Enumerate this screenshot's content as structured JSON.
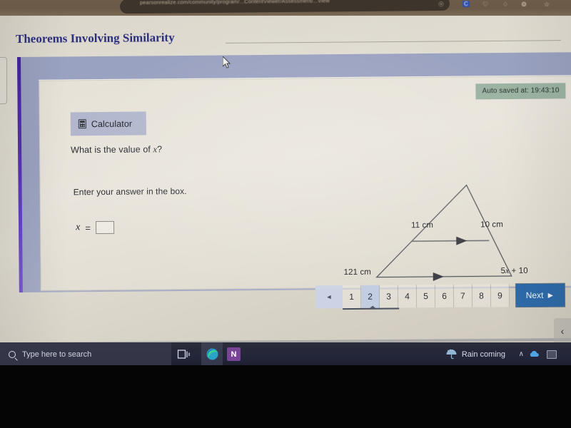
{
  "browser": {
    "url": "pearsonrealize.com/community/program/...ContentViewer/Assessment/...View",
    "toolbar_icons": [
      "account-icon",
      "extensions-icon",
      "favorites-icon",
      "collections-icon",
      "browser-essentials-icon",
      "profile-icon"
    ]
  },
  "page": {
    "heading": "Theorems Involving Similarity"
  },
  "assessment": {
    "autosave": "Auto saved at: 19:43:10",
    "calculator_label": "Calculator",
    "question": "What is the value of x?",
    "question_prefix": "What is the value of ",
    "question_variable": "x",
    "question_suffix": "?",
    "instruction": "Enter your answer in the box.",
    "answer_variable": "x",
    "answer_equals": "=",
    "answer_value": "",
    "answer_placeholder": ""
  },
  "figure": {
    "type": "triangle-with-midsegment",
    "description": "Triangle with a parallel segment (midsegment) drawn across it; arrowheads mark the two parallel lines.",
    "labels": {
      "upper_left_side": "11 cm",
      "upper_right_side": "10 cm",
      "lower_left_side": "121 cm",
      "lower_right_side": "5x + 10"
    },
    "label_upper_right_expression_prefix": "5",
    "label_upper_right_expression_var": "x",
    "label_upper_right_expression_suffix": " + 10"
  },
  "pagination": {
    "prev_label": "◄",
    "pages": [
      "1",
      "2",
      "3",
      "4",
      "5",
      "6",
      "7",
      "8",
      "9"
    ],
    "active_page": "2",
    "next_label": "Next",
    "next_arrow": "►"
  },
  "collapse": {
    "label": "‹"
  },
  "taskbar": {
    "search_placeholder": "Type here to search",
    "taskview_name": "task-view-icon",
    "edge_name": "edge-browser-icon",
    "onenote_label": "N",
    "weather_text": "Rain coming",
    "tray_chevron": "∧"
  },
  "colors": {
    "shell_blue_grey": "#9aa2c1",
    "accent_purple": "#5b34b8",
    "next_button_blue": "#2d6aa8",
    "autosave_green": "#9cb3a2",
    "calc_button": "#b2b7cd",
    "heading_navy": "#2b2f7a",
    "taskbar": "#24263a"
  }
}
